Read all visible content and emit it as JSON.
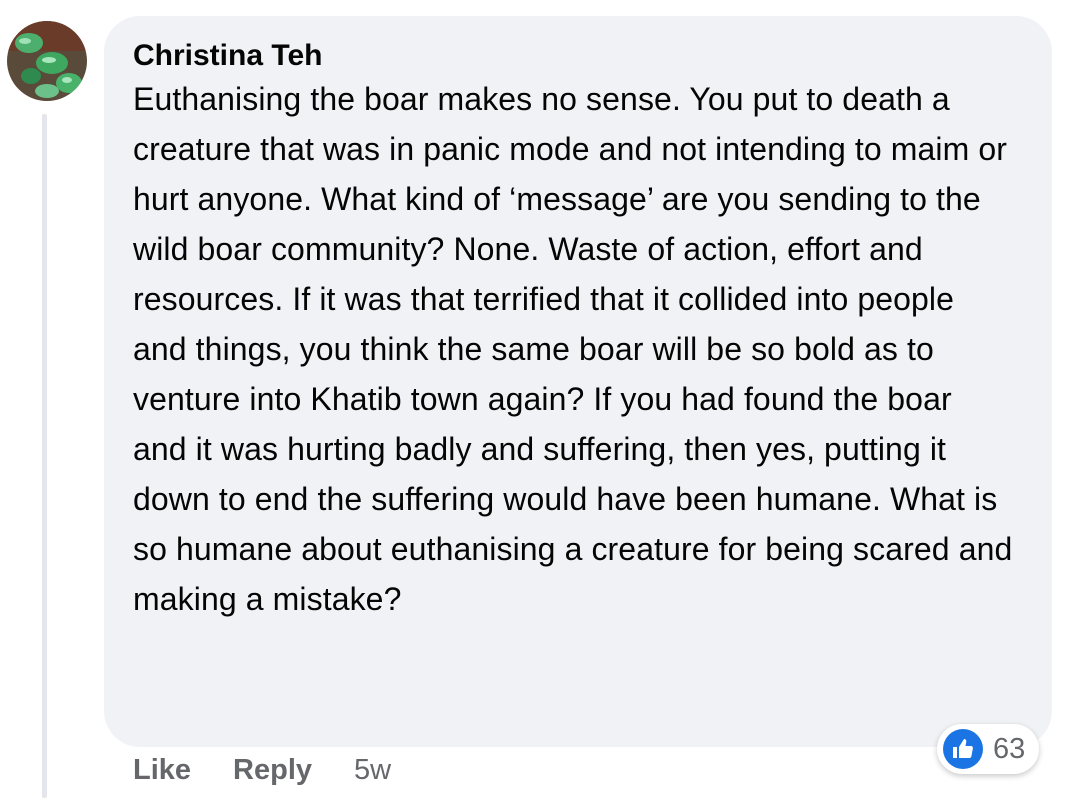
{
  "comment": {
    "author": "Christina Teh",
    "text": "Euthanising the boar makes no sense. You put to death a creature that was in panic mode and not intending to maim or hurt anyone. What kind of ‘message’ are you sending to the wild boar community? None. Waste of action, effort and resources. If it was that terrified that it collided into people and things, you think the same boar will be so bold as to venture into Khatib town again? If you had found the boar and it was hurting badly and suffering, then yes, putting it down to end the suffering would have been humane. What is so humane about euthanising a creature for being scared and making a mistake?",
    "actions": {
      "like_label": "Like",
      "reply_label": "Reply",
      "timestamp": "5w"
    },
    "reactions": {
      "icon": "thumbs-up-icon",
      "count": "63",
      "color": "#1b74e4"
    }
  },
  "colors": {
    "bubble_bg": "#f0f2f5",
    "text": "#050505",
    "secondary_text": "#65676b"
  }
}
